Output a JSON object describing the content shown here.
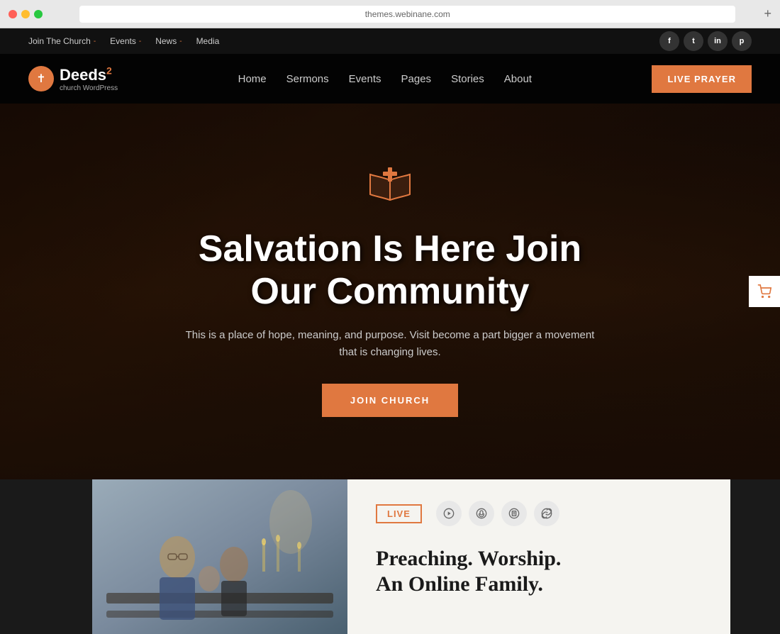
{
  "browser": {
    "url": "themes.webinane.com",
    "add_tab": "+"
  },
  "top_bar": {
    "items": [
      {
        "label": "Join The Church",
        "has_arrow": true
      },
      {
        "label": "Events",
        "has_arrow": true
      },
      {
        "label": "News",
        "has_arrow": true
      },
      {
        "label": "Media"
      }
    ],
    "social": [
      {
        "icon": "f",
        "name": "facebook"
      },
      {
        "icon": "t",
        "name": "twitter"
      },
      {
        "icon": "in",
        "name": "linkedin"
      },
      {
        "icon": "p",
        "name": "pinterest"
      }
    ]
  },
  "header": {
    "logo_name": "Deeds",
    "logo_sup": "2",
    "logo_sub": "church WordPress",
    "nav": [
      {
        "label": "Home"
      },
      {
        "label": "Sermons"
      },
      {
        "label": "Events"
      },
      {
        "label": "Pages"
      },
      {
        "label": "Stories"
      },
      {
        "label": "About"
      }
    ],
    "live_prayer": "LIVE PRAYER"
  },
  "hero": {
    "title": "Salvation Is Here Join Our Community",
    "subtitle": "This is a place of hope, meaning, and purpose. Visit become a part bigger a movement that is changing lives.",
    "cta": "JOIN CHURCH"
  },
  "bottom": {
    "live_badge": "LIVE",
    "title": "Preaching. Worship.\nAn Online Family.",
    "media_icons": [
      "▶",
      "♪",
      "📄",
      "🔗"
    ]
  },
  "accent_color": "#e07840"
}
